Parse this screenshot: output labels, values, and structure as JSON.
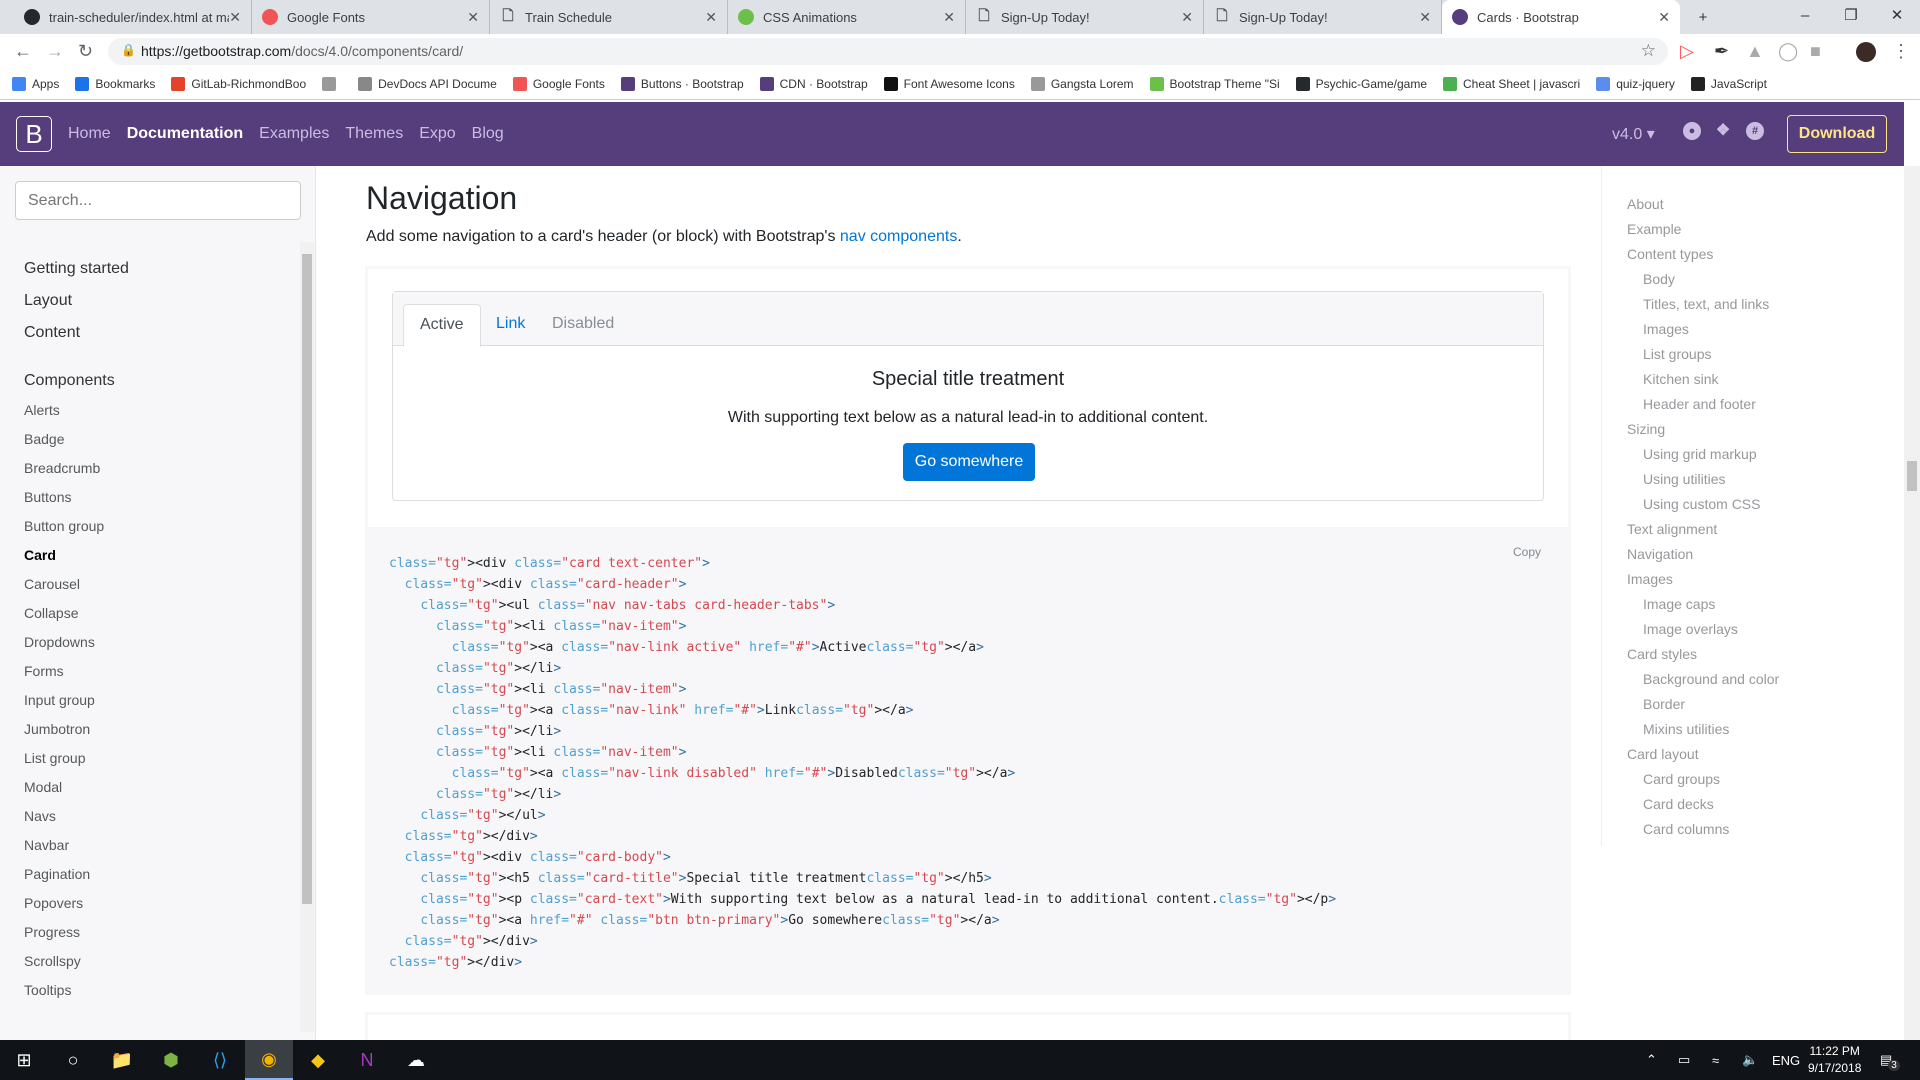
{
  "browser": {
    "tabs": [
      {
        "label": "train-scheduler/index.html at ma",
        "icon": "github-icon",
        "color": "#24292e"
      },
      {
        "label": "Google Fonts",
        "icon": "google-fonts-icon",
        "color": "#f05454"
      },
      {
        "label": "Train Schedule",
        "icon": "page-icon",
        "color": ""
      },
      {
        "label": "CSS Animations",
        "icon": "w3schools-icon",
        "color": "#6cc04a"
      },
      {
        "label": "Sign-Up Today!",
        "icon": "page-icon",
        "color": ""
      },
      {
        "label": "Sign-Up Today!",
        "icon": "page-icon",
        "color": ""
      },
      {
        "label": "Cards · Bootstrap",
        "icon": "bootstrap-icon",
        "color": "#563d7c",
        "active": true
      }
    ],
    "url_host": "https://getbootstrap.com",
    "url_path": "/docs/4.0/components/card/",
    "bookmarks": [
      "Apps",
      "Bookmarks",
      "GitLab-RichmondBoo",
      "",
      "DevDocs API Docume",
      "Google Fonts",
      "Buttons · Bootstrap",
      "CDN · Bootstrap",
      "Font Awesome Icons",
      "Gangsta Lorem",
      "Bootstrap Theme \"Si",
      "Psychic-Game/game",
      "Cheat Sheet | javascri",
      "quiz-jquery",
      "JavaScript"
    ]
  },
  "navbar": {
    "brand": "B",
    "links": [
      "Home",
      "Documentation",
      "Examples",
      "Themes",
      "Expo",
      "Blog"
    ],
    "active": "Documentation",
    "version": "v4.0",
    "download": "Download",
    "accent": "#563d7c"
  },
  "sidebar": {
    "search_placeholder": "Search...",
    "groups": [
      "Getting started",
      "Layout",
      "Content",
      "Components"
    ],
    "items": [
      "Alerts",
      "Badge",
      "Breadcrumb",
      "Buttons",
      "Button group",
      "Card",
      "Carousel",
      "Collapse",
      "Dropdowns",
      "Forms",
      "Input group",
      "Jumbotron",
      "List group",
      "Modal",
      "Navs",
      "Navbar",
      "Pagination",
      "Popovers",
      "Progress",
      "Scrollspy",
      "Tooltips"
    ],
    "active": "Card"
  },
  "main": {
    "title": "Navigation",
    "lead_pre": "Add some navigation to a card's header (or block) with Bootstrap's ",
    "lead_link": "nav components",
    "lead_post": ".",
    "card": {
      "tabs": [
        "Active",
        "Link",
        "Disabled"
      ],
      "title": "Special title treatment",
      "text": "With supporting text below as a natural lead-in to additional content.",
      "button": "Go somewhere"
    },
    "copy": "Copy",
    "code": [
      "<div class=\"card text-center\">",
      "  <div class=\"card-header\">",
      "    <ul class=\"nav nav-tabs card-header-tabs\">",
      "      <li class=\"nav-item\">",
      "        <a class=\"nav-link active\" href=\"#\">Active</a>",
      "      </li>",
      "      <li class=\"nav-item\">",
      "        <a class=\"nav-link\" href=\"#\">Link</a>",
      "      </li>",
      "      <li class=\"nav-item\">",
      "        <a class=\"nav-link disabled\" href=\"#\">Disabled</a>",
      "      </li>",
      "    </ul>",
      "  </div>",
      "  <div class=\"card-body\">",
      "    <h5 class=\"card-title\">Special title treatment</h5>",
      "    <p class=\"card-text\">With supporting text below as a natural lead-in to additional content.</p>",
      "    <a href=\"#\" class=\"btn btn-primary\">Go somewhere</a>",
      "  </div>",
      "</div>"
    ]
  },
  "toc": [
    {
      "label": "About",
      "level": 1
    },
    {
      "label": "Example",
      "level": 1
    },
    {
      "label": "Content types",
      "level": 1
    },
    {
      "label": "Body",
      "level": 2
    },
    {
      "label": "Titles, text, and links",
      "level": 2
    },
    {
      "label": "Images",
      "level": 2
    },
    {
      "label": "List groups",
      "level": 2
    },
    {
      "label": "Kitchen sink",
      "level": 2
    },
    {
      "label": "Header and footer",
      "level": 2
    },
    {
      "label": "Sizing",
      "level": 1
    },
    {
      "label": "Using grid markup",
      "level": 2
    },
    {
      "label": "Using utilities",
      "level": 2
    },
    {
      "label": "Using custom CSS",
      "level": 2
    },
    {
      "label": "Text alignment",
      "level": 1
    },
    {
      "label": "Navigation",
      "level": 1
    },
    {
      "label": "Images",
      "level": 1
    },
    {
      "label": "Image caps",
      "level": 2
    },
    {
      "label": "Image overlays",
      "level": 2
    },
    {
      "label": "Card styles",
      "level": 1
    },
    {
      "label": "Background and color",
      "level": 2
    },
    {
      "label": "Border",
      "level": 2
    },
    {
      "label": "Mixins utilities",
      "level": 2
    },
    {
      "label": "Card layout",
      "level": 1
    },
    {
      "label": "Card groups",
      "level": 2
    },
    {
      "label": "Card decks",
      "level": 2
    },
    {
      "label": "Card columns",
      "level": 2
    }
  ],
  "taskbar": {
    "apps": [
      "windows-start-icon",
      "search-icon",
      "file-explorer-icon",
      "android-studio-icon",
      "vscode-icon",
      "chrome-icon",
      "gitkraken-icon",
      "onenote-icon",
      "cloud-app-icon"
    ],
    "active": "chrome-icon",
    "lang": "ENG",
    "time": "11:22 PM",
    "date": "9/17/2018",
    "notifications": "3"
  }
}
